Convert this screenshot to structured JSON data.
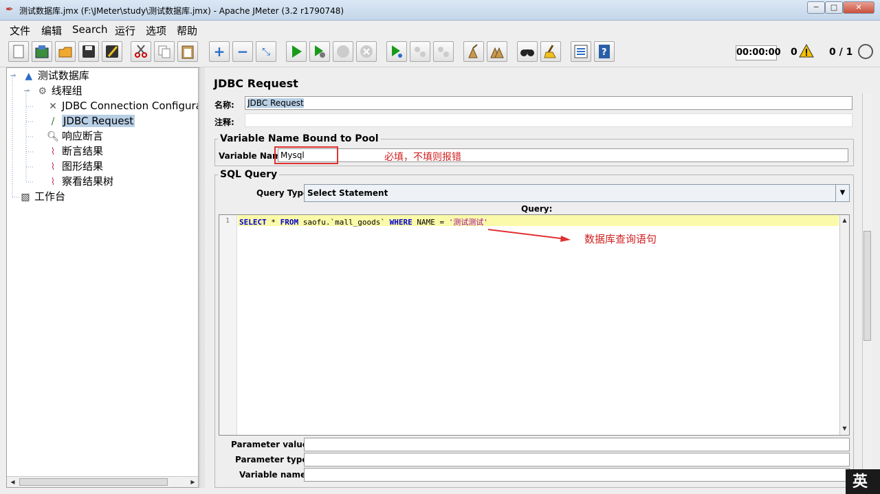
{
  "window": {
    "title": "测试数据库.jmx (F:\\JMeter\\study\\测试数据库.jmx) - Apache JMeter (3.2 r1790748)",
    "minimize": "─",
    "maximize": "□",
    "close": "✕"
  },
  "menu": [
    "文件",
    "编辑",
    "Search",
    "运行",
    "选项",
    "帮助"
  ],
  "toolbar": {
    "icons": [
      "new-icon",
      "templates-icon",
      "open-icon",
      "save-icon",
      "save-as-icon",
      "cut-icon",
      "copy-icon",
      "paste-icon",
      "expand-icon",
      "collapse-icon",
      "toggle-icon",
      "start-icon",
      "start-no-timers-icon",
      "stop-icon",
      "shutdown-icon",
      "remote-start-icon",
      "remote-stop-icon",
      "remote-shutdown-icon",
      "clear-icon",
      "clear-all-icon",
      "search-icon",
      "reset-search-icon",
      "function-helper-icon",
      "help-icon"
    ],
    "timer": "00:00:00",
    "error_count": "0",
    "threads": "0 / 1"
  },
  "tree": [
    {
      "label": "测试数据库",
      "icon": "test-plan-icon",
      "depth": 0
    },
    {
      "label": "线程组",
      "icon": "thread-group-icon",
      "depth": 1
    },
    {
      "label": "JDBC Connection Configuration",
      "icon": "config-element-icon",
      "depth": 2
    },
    {
      "label": "JDBC Request",
      "icon": "sampler-icon",
      "depth": 2,
      "selected": true
    },
    {
      "label": "响应断言",
      "icon": "assertion-icon",
      "depth": 2
    },
    {
      "label": "断言结果",
      "icon": "listener-icon",
      "depth": 2
    },
    {
      "label": "图形结果",
      "icon": "listener-icon",
      "depth": 2
    },
    {
      "label": "察看结果树",
      "icon": "listener-icon",
      "depth": 2
    },
    {
      "label": "工作台",
      "icon": "workbench-icon",
      "depth": 0
    }
  ],
  "panel": {
    "title": "JDBC Request",
    "name_label": "名称:",
    "name_value": "JDBC Request",
    "comment_label": "注释:",
    "comment_value": "",
    "pool_group_title": "Variable Name Bound to Pool",
    "var_name_label": "Variable Name:",
    "var_name_value": "Mysql",
    "var_annotation": "必填，不填则报错",
    "sql_group_title": "SQL Query",
    "query_type_label": "Query Type:",
    "query_type_value": "Select Statement",
    "query_label": "Query:",
    "query_line_number": "1",
    "query_tokens": [
      {
        "t": "SELECT",
        "c": "kw"
      },
      {
        "t": " * ",
        "c": ""
      },
      {
        "t": "FROM",
        "c": "kw"
      },
      {
        "t": " saofu.`mall_goods` ",
        "c": ""
      },
      {
        "t": "WHERE",
        "c": "kw"
      },
      {
        "t": " NAME = ",
        "c": ""
      },
      {
        "t": "'测试测试'",
        "c": "str"
      }
    ],
    "query_annotation": "数据库查询语句",
    "param_values_label": "Parameter values:",
    "param_types_label": "Parameter types:",
    "variable_names_label": "Variable names:"
  },
  "ime": "英",
  "colors": {
    "annotation": "#d21f1f",
    "selection": "#b8cfe5",
    "current_line": "#fbfaaa"
  }
}
